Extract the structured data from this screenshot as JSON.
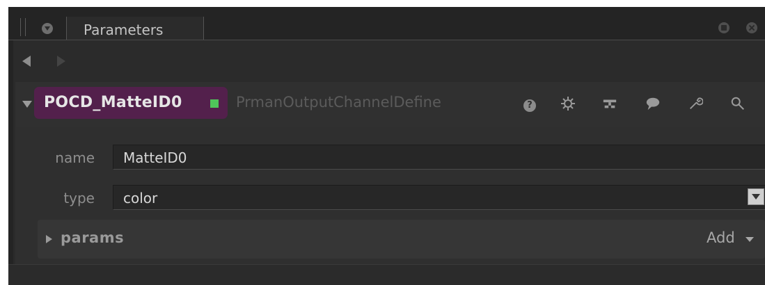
{
  "tab": {
    "label": "Parameters"
  },
  "node": {
    "name": "POCD_MatteID0",
    "type": "PrmanOutputChannelDefine",
    "status_color": "#4fc55a",
    "pill_color": "#53204c"
  },
  "header_icons": {
    "help_text": "?",
    "icons": [
      "help-icon",
      "gear-icon",
      "node-graph-icon",
      "comment-icon",
      "wrench-icon",
      "magnifier-icon"
    ]
  },
  "fields": {
    "name": {
      "label": "name",
      "value": "MatteID0"
    },
    "type": {
      "label": "type",
      "value": "color"
    }
  },
  "params_group": {
    "label": "params",
    "add_label": "Add"
  }
}
